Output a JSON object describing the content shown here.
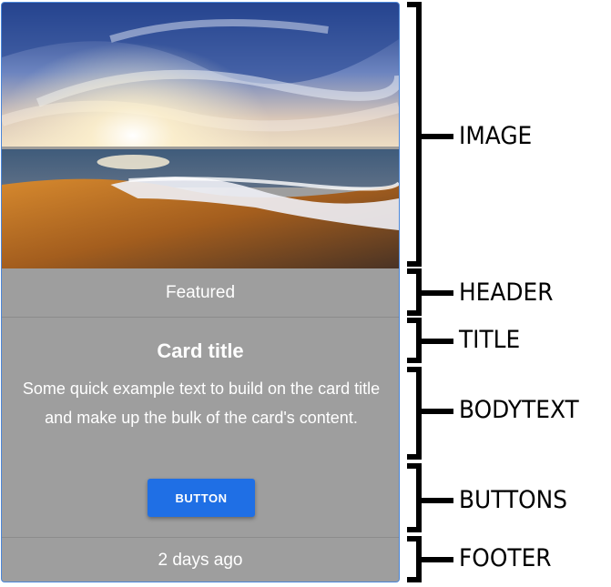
{
  "card": {
    "header": "Featured",
    "title": "Card title",
    "body_text": "Some quick example text to build on the card title and make up the bulk of the card's content.",
    "button_label": "BUTTON",
    "footer": "2 days ago",
    "colors": {
      "card_background": "#9e9e9e",
      "button": "#1f6fe5",
      "border": "#4a86d9"
    }
  },
  "annotations": {
    "image": "IMAGE",
    "header": "HEADER",
    "title": "TITLE",
    "bodytext": "BODYTEXT",
    "buttons": "BUTTONS",
    "footer": "FOOTER"
  }
}
